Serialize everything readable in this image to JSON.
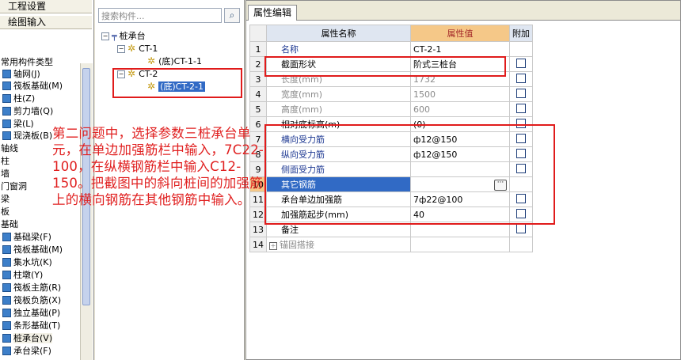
{
  "left_panel": {
    "buttons": [
      "工程设置",
      "绘图输入"
    ],
    "category_title": "常用构件类型",
    "items": [
      {
        "label": "轴网(J)",
        "icon": "axis-grid-icon"
      },
      {
        "label": "筏板基础(M)",
        "icon": "raft-foundation-icon"
      },
      {
        "label": "柱(Z)",
        "icon": "column-icon"
      },
      {
        "label": "剪力墙(Q)",
        "icon": "shear-wall-icon"
      },
      {
        "label": "梁(L)",
        "icon": "beam-icon"
      },
      {
        "label": "现浇板(B)",
        "icon": "slab-icon"
      },
      {
        "label": "轴线",
        "icon": ""
      },
      {
        "label": "柱",
        "icon": ""
      },
      {
        "label": "墙",
        "icon": ""
      },
      {
        "label": "门窗洞",
        "icon": ""
      },
      {
        "label": "梁",
        "icon": ""
      },
      {
        "label": "板",
        "icon": ""
      },
      {
        "label": "基础",
        "icon": ""
      },
      {
        "label": "基础梁(F)",
        "icon": "foundation-beam-icon"
      },
      {
        "label": "筏板基础(M)",
        "icon": "raft-foundation-icon"
      },
      {
        "label": "集水坑(K)",
        "icon": "sump-pit-icon"
      },
      {
        "label": "柱墩(Y)",
        "icon": "column-pier-icon"
      },
      {
        "label": "筏板主筋(R)",
        "icon": "raft-main-rebar-icon"
      },
      {
        "label": "筏板负筋(X)",
        "icon": "raft-negative-rebar-icon"
      },
      {
        "label": "独立基础(P)",
        "icon": "isolated-footing-icon"
      },
      {
        "label": "条形基础(T)",
        "icon": "strip-footing-icon"
      },
      {
        "label": "桩承台(V)",
        "icon": "pile-cap-icon"
      },
      {
        "label": "承台梁(F)",
        "icon": "cap-beam-icon"
      }
    ]
  },
  "tree": {
    "search_placeholder": "搜索构件...",
    "root": "桩承台",
    "nodes": [
      {
        "label": "CT-1",
        "child": "(底)CT-1-1"
      },
      {
        "label": "CT-2",
        "child": "(底)CT-2-1"
      }
    ]
  },
  "props": {
    "tab": "属性编辑",
    "headers": [
      "属性名称",
      "属性值",
      "附加"
    ],
    "rows": [
      {
        "num": "1",
        "name": "名称",
        "value": "CT-2-1",
        "style": "blue",
        "checkbox": false
      },
      {
        "num": "2",
        "name": "截面形状",
        "value": "阶式三桩台",
        "style": "",
        "checkbox": true
      },
      {
        "num": "3",
        "name": "长度(mm)",
        "value": "1732",
        "style": "gray",
        "checkbox": true
      },
      {
        "num": "4",
        "name": "宽度(mm)",
        "value": "1500",
        "style": "gray",
        "checkbox": true
      },
      {
        "num": "5",
        "name": "高度(mm)",
        "value": "600",
        "style": "gray",
        "checkbox": true
      },
      {
        "num": "6",
        "name": "相对底标高(m)",
        "value": "(0)",
        "style": "",
        "checkbox": true
      },
      {
        "num": "7",
        "name": "横向受力筋",
        "value": "ф12@150",
        "style": "blue",
        "checkbox": true
      },
      {
        "num": "8",
        "name": "纵向受力筋",
        "value": "ф12@150",
        "style": "blue",
        "checkbox": true
      },
      {
        "num": "9",
        "name": "侧面受力筋",
        "value": "",
        "style": "blue",
        "checkbox": true
      },
      {
        "num": "10",
        "name": "其它钢筋",
        "value": "",
        "style": "selected",
        "checkbox": false
      },
      {
        "num": "11",
        "name": "承台单边加强筋",
        "value": "7ф22@100",
        "style": "",
        "checkbox": true
      },
      {
        "num": "12",
        "name": "加强筋起步(mm)",
        "value": "40",
        "style": "",
        "checkbox": true
      },
      {
        "num": "13",
        "name": "备注",
        "value": "",
        "style": "",
        "checkbox": true
      },
      {
        "num": "14",
        "name": "锚固搭接",
        "value": "",
        "style": "gray-expand",
        "checkbox": false
      }
    ]
  },
  "annotation": "第二问题中，选择参数三桩承台单元，在单边加强筋栏中输入，7C22-100，在纵横钢筋栏中输入C12-150。把截图中的斜向桩间的加强筋上的横向钢筋在其他钢筋中输入。"
}
